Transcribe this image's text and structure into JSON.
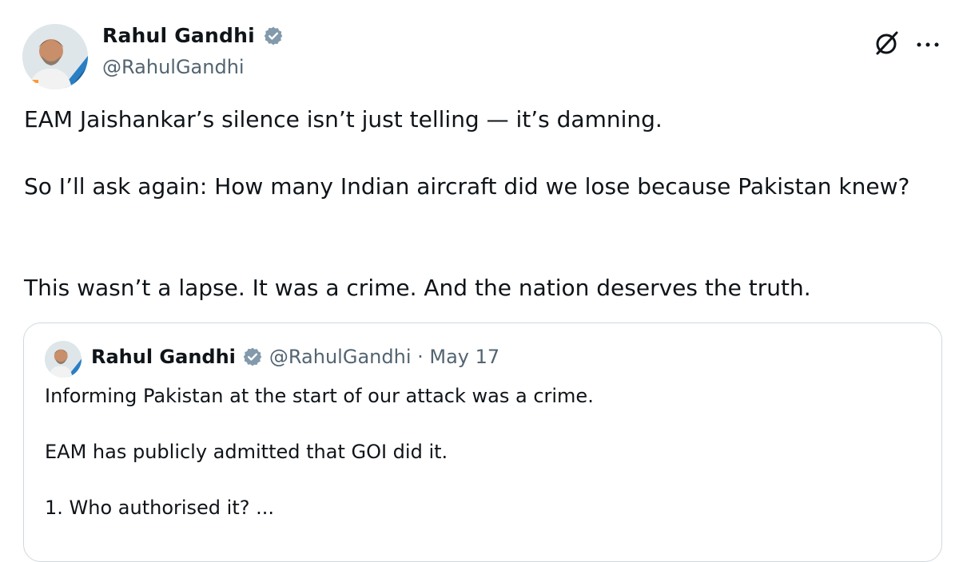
{
  "author": {
    "name": "Rahul Gandhi",
    "handle": "@RahulGandhi"
  },
  "tweet": {
    "paragraphs": [
      "EAM Jaishankar’s silence isn’t just telling — it’s damning.",
      "So I’ll ask again: How many Indian aircraft did we lose because Pakistan knew?",
      "This wasn’t a lapse. It was a crime. And the nation deserves the truth."
    ]
  },
  "quoted_tweet": {
    "name": "Rahul Gandhi",
    "meta": "@RahulGandhi · May 17",
    "lines": [
      "Informing Pakistan at the start of our attack was a crime.",
      "EAM has publicly admitted that GOI did it.",
      "1. Who authorised it? ..."
    ]
  },
  "icons": {
    "verified": "verified-badge-icon",
    "grok": "grok-icon",
    "more": "more-options-icon"
  },
  "colors": {
    "text": "#0f1419",
    "secondary": "#536471",
    "verified": "#829aab",
    "border": "#cfd9de"
  }
}
